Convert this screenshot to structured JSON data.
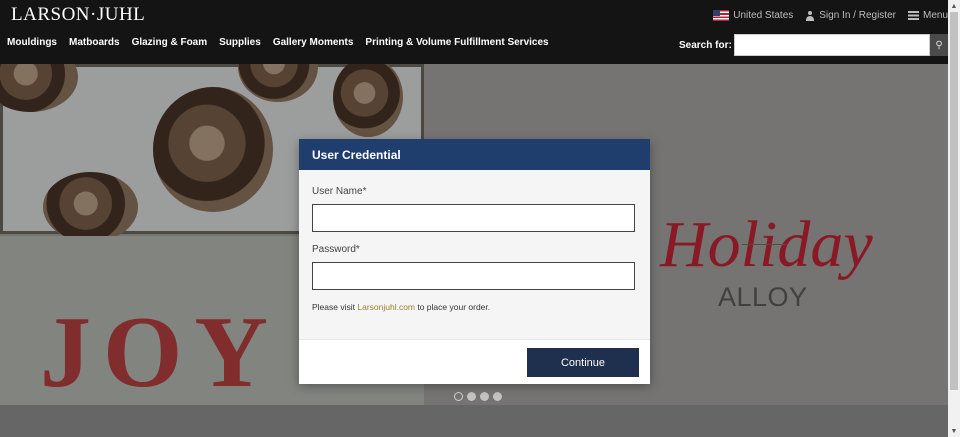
{
  "header": {
    "logo": "LARSON·JUHL",
    "country": "United States",
    "signin": "Sign In / Register",
    "menu": "Menu",
    "nav": [
      "Mouldings",
      "Matboards",
      "Glazing & Foam",
      "Supplies",
      "Gallery Moments",
      "Printing & Volume Fulfillment Services"
    ],
    "search_label": "Search for:",
    "search_value": ""
  },
  "hero": {
    "joy_text": "JOY",
    "holiday_text": "Holiday",
    "alloy_text": "ALLOY",
    "carousel_total": 4,
    "carousel_active": 1
  },
  "modal": {
    "title": "User Credential",
    "username_label": "User Name*",
    "username_value": "",
    "password_label": "Password*",
    "password_value": "",
    "note_prefix": "Please visit ",
    "note_link": "Larsonjuhl.com",
    "note_suffix": " to place your order.",
    "button": "Continue"
  },
  "colors": {
    "header_bg": "#141414",
    "modal_header": "#1f3d6d",
    "button_bg": "#1f2f4e",
    "link": "#9a7d2c",
    "holiday_red": "#a81f2e"
  }
}
